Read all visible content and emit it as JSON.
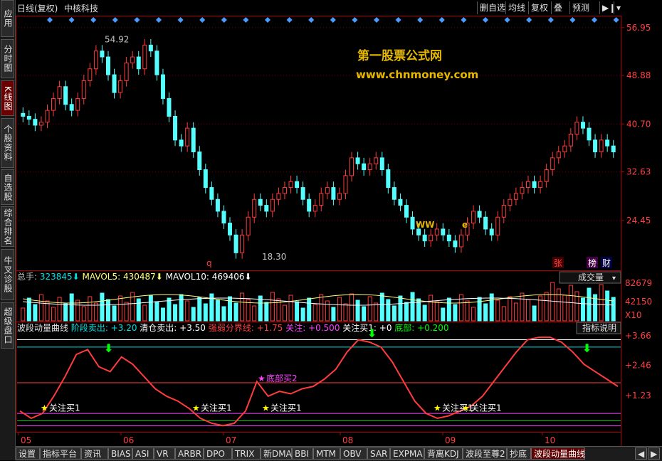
{
  "sidebar": {
    "items": [
      {
        "label": "应用",
        "active": false
      },
      {
        "label": "分时图",
        "active": false
      },
      {
        "label": "K线图",
        "active": true
      },
      {
        "label": "个股资料",
        "active": false
      },
      {
        "label": "自选股",
        "active": false
      },
      {
        "label": "综合排名",
        "active": false
      },
      {
        "label": "牛叉诊股",
        "active": false
      },
      {
        "label": "超级盘口",
        "active": false
      }
    ]
  },
  "header": {
    "period": "日线(复权)",
    "stock_name": "中核科技",
    "buttons": [
      "删自选",
      "均线",
      "复权",
      "叠",
      "预测"
    ],
    "nav_icon": "play-bar-icon",
    "menu_icon": "dropdown-arrow-icon"
  },
  "watermark": {
    "line1": "第一股票公式网",
    "line2": "www.chnmoney.com"
  },
  "price_axis": {
    "ticks": [
      "56.95",
      "48.88",
      "40.70",
      "32.63",
      "24.45"
    ]
  },
  "price_annotations": {
    "high": "54.92",
    "low": "18.30"
  },
  "markers": {
    "q": "q",
    "zhang": "张",
    "bang": "榜",
    "cai": "财",
    "ww": "WW",
    "e": "e"
  },
  "volume_panel": {
    "total_label": "总手:",
    "total_value": "323845",
    "mavol5_label": "MAVOL5:",
    "mavol5_value": "430487",
    "mavol10_label": "MAVOL10:",
    "mavol10_value": "469406",
    "dropdown": "成交量",
    "axis": [
      "82679",
      "42150",
      "X10"
    ]
  },
  "indicator_panel": {
    "name": "波段动量曲线",
    "items": [
      {
        "label": "阶段卖出:",
        "value": "+3.20",
        "color": "#00e0e0"
      },
      {
        "label": "清仓卖出:",
        "value": "+3.50",
        "color": "#ffffff"
      },
      {
        "label": "强弱分界线:",
        "value": "+1.75",
        "color": "#ff4040"
      },
      {
        "label": "关注:",
        "value": "+0.500",
        "color": "#ff40ff"
      },
      {
        "label": "关注买1:",
        "value": "+0",
        "color": "#ffffff"
      },
      {
        "label": "底部:",
        "value": "+0.200",
        "color": "#00ff00"
      }
    ],
    "help": "指标说明",
    "axis": [
      "+3.66",
      "+2.46",
      "+1.23"
    ],
    "annotations": [
      "关注买1",
      "关注买1",
      "关注买1",
      "关注买1",
      "关注买1",
      "底部买2"
    ]
  },
  "time_axis": {
    "labels": [
      "05",
      "06",
      "07",
      "08",
      "09",
      "10"
    ]
  },
  "bottom_tabs": [
    "设置",
    "指标平台",
    "资讯",
    "BIAS",
    "ASI",
    "VR",
    "ARBR",
    "DPO",
    "TRIX",
    "新DMA",
    "BBI",
    "MTM",
    "OBV",
    "SAR",
    "EXPMA",
    "背离KDJ",
    "波段至尊2",
    "抄底",
    "波段动量曲线"
  ],
  "active_tab": "波段动量曲线",
  "colors": {
    "up": "#ff3c3c",
    "down": "#54ffff",
    "axis": "#b00000",
    "grid": "#800000",
    "cyan": "#00e0e0",
    "magenta": "#ff40ff",
    "yellow": "#ffff00",
    "white": "#ffffff",
    "green": "#00ff00"
  },
  "chart_data": {
    "type": "candlestick",
    "title": "中核科技 日线(复权)",
    "x_months": [
      "05",
      "06",
      "07",
      "08",
      "09",
      "10"
    ],
    "y_ticks": [
      56.95,
      48.88,
      40.7,
      32.63,
      24.45
    ],
    "ylim": [
      17,
      58
    ],
    "closes": [
      42,
      41.5,
      40.5,
      41,
      43,
      45,
      47,
      44,
      43,
      45,
      48,
      50,
      53,
      52,
      49,
      46,
      48,
      51,
      52,
      50,
      54,
      53,
      49,
      45,
      42,
      38,
      37,
      40,
      36,
      33,
      30,
      28,
      26,
      24,
      22,
      19,
      22,
      25,
      28,
      27,
      26,
      28,
      29,
      30,
      31,
      30,
      28,
      26,
      27,
      29,
      30,
      28,
      29,
      32,
      35,
      34,
      33,
      34,
      35,
      33,
      30,
      28,
      27,
      25,
      23,
      22,
      21,
      22,
      23,
      22,
      21,
      20,
      22,
      24,
      26,
      25,
      23,
      22,
      25,
      27,
      28,
      29,
      30,
      31,
      30,
      31,
      33,
      35,
      36,
      37,
      39,
      41,
      40,
      38,
      36,
      38,
      37,
      36
    ]
  }
}
